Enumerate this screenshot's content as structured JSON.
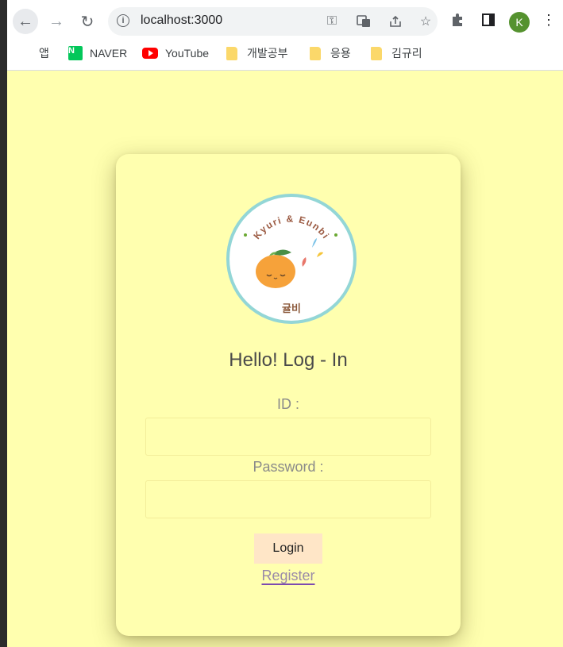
{
  "browser": {
    "url": "localhost:3000",
    "profile_initial": "K",
    "icons": {
      "back": "back-arrow-icon",
      "forward": "forward-arrow-icon",
      "reload": "reload-icon",
      "info": "info-icon"
    },
    "bookmarks": [
      {
        "label": "앱",
        "icon": "apps-grid-icon"
      },
      {
        "label": "NAVER",
        "icon": "naver-icon"
      },
      {
        "label": "YouTube",
        "icon": "youtube-icon"
      },
      {
        "label": "개발공부",
        "icon": "folder-icon"
      },
      {
        "label": "응용",
        "icon": "folder-icon"
      },
      {
        "label": "김규리",
        "icon": "folder-icon"
      }
    ]
  },
  "page": {
    "background": "#ffffaf",
    "logo": {
      "top_text": "Kyuri & Eunbi",
      "bottom_text": "귤비"
    },
    "title": "Hello! Log - In",
    "id_label": "ID :",
    "id_value": "",
    "password_label": "Password :",
    "password_value": "",
    "login_label": "Login",
    "register_label": "Register"
  }
}
